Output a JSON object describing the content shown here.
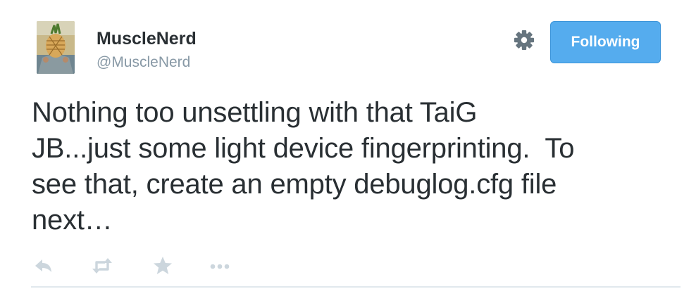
{
  "user": {
    "display_name": "MuscleNerd",
    "handle": "@MuscleNerd",
    "avatar_icon": "avatar-photo"
  },
  "header": {
    "settings_icon": "gear-icon",
    "follow_button_label": "Following"
  },
  "tweet": {
    "text": "Nothing too unsettling with that TaiG\nJB...just some light device fingerprinting.  To\nsee that, create an empty debuglog.cfg file\nnext…"
  },
  "actions": [
    {
      "name": "reply",
      "icon": "reply-icon"
    },
    {
      "name": "retweet",
      "icon": "retweet-icon"
    },
    {
      "name": "favorite",
      "icon": "star-icon"
    },
    {
      "name": "more",
      "icon": "more-icon"
    }
  ],
  "colors": {
    "text": "#292f33",
    "muted": "#8899a6",
    "accent": "#55acee",
    "action_icon": "#ccd6dd",
    "divider": "#e1e8ed"
  }
}
